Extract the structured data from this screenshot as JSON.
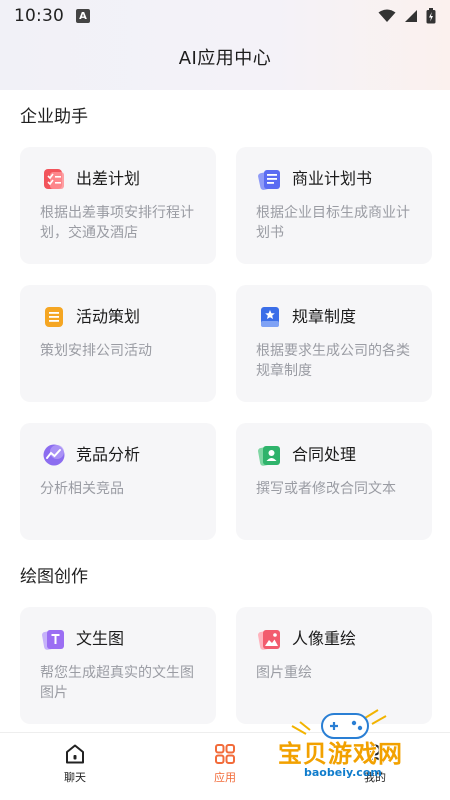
{
  "status_bar": {
    "time": "10:30",
    "notification_glyph": "A"
  },
  "header": {
    "title": "AI应用中心"
  },
  "sections": [
    {
      "title": "企业助手",
      "cards": [
        {
          "title": "出差计划",
          "desc": "根据出差事项安排行程计划，交通及酒店",
          "icon": "travel-plan-icon",
          "color": "#f2545b"
        },
        {
          "title": "商业计划书",
          "desc": "根据企业目标生成商业计划书",
          "icon": "business-plan-icon",
          "color": "#5b6cf2"
        },
        {
          "title": "活动策划",
          "desc": "策划安排公司活动",
          "icon": "event-plan-icon",
          "color": "#f5a623"
        },
        {
          "title": "规章制度",
          "desc": "根据要求生成公司的各类规章制度",
          "icon": "regulations-icon",
          "color": "#3b6ee8"
        },
        {
          "title": "竞品分析",
          "desc": "分析相关竞品",
          "icon": "competitor-analysis-icon",
          "color": "#8c6df0"
        },
        {
          "title": "合同处理",
          "desc": "撰写或者修改合同文本",
          "icon": "contract-icon",
          "color": "#2fb36b"
        }
      ]
    },
    {
      "title": "绘图创作",
      "cards": [
        {
          "title": "文生图",
          "desc": "帮您生成超真实的文生图图片",
          "icon": "text-to-image-icon",
          "color": "#9b6ef3"
        },
        {
          "title": "人像重绘",
          "desc": "图片重绘",
          "icon": "portrait-redraw-icon",
          "color": "#f25c6e"
        }
      ]
    }
  ],
  "bottom_nav": [
    {
      "label": "聊天",
      "icon": "home-icon",
      "active": false
    },
    {
      "label": "应用",
      "icon": "apps-grid-icon",
      "active": true
    },
    {
      "label": "我的",
      "icon": "profile-icon",
      "active": false
    }
  ],
  "watermark": {
    "title": "宝贝游戏网",
    "url": "baobeiy.com"
  },
  "colors": {
    "accent": "#f26b3a",
    "text_primary": "#1f1f1f",
    "text_secondary": "#9a9ca3",
    "card_bg": "#f6f6f8"
  }
}
